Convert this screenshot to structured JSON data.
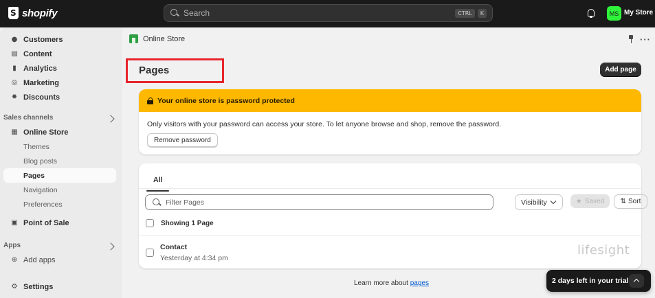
{
  "topbar": {
    "brand": "shopify",
    "search_placeholder": "Search",
    "shortcut_keys": [
      "CTRL",
      "K"
    ],
    "avatar_initials": "MS",
    "store_name": "My Store"
  },
  "sidebar": {
    "items": [
      {
        "label": "Customers",
        "icon": "person-icon"
      },
      {
        "label": "Content",
        "icon": "content-icon"
      },
      {
        "label": "Analytics",
        "icon": "bar-chart-icon"
      },
      {
        "label": "Marketing",
        "icon": "target-icon"
      },
      {
        "label": "Discounts",
        "icon": "discount-icon"
      }
    ],
    "sales_channels_label": "Sales channels",
    "online_store": {
      "label": "Online Store",
      "icon": "store-icon"
    },
    "sub_items": [
      "Themes",
      "Blog posts",
      "Pages",
      "Navigation",
      "Preferences"
    ],
    "point_of_sale": {
      "label": "Point of Sale",
      "icon": "pos-icon"
    },
    "apps_label": "Apps",
    "add_apps": "Add apps",
    "settings": "Settings"
  },
  "breadcrumb": {
    "label": "Online Store"
  },
  "page": {
    "title": "Pages",
    "add_button": "Add page"
  },
  "banner": {
    "title": "Your online store is password protected",
    "body": "Only visitors with your password can access your store. To let anyone browse and shop, remove the password.",
    "button": "Remove password",
    "color": "#ffb800"
  },
  "list": {
    "tab": "All",
    "filter_placeholder": "Filter Pages",
    "visibility": "Visibility",
    "saved": "Saved",
    "sort": "Sort",
    "showing": "Showing 1 Page",
    "rows": [
      {
        "title": "Contact",
        "date": "Yesterday at 4:34 pm"
      }
    ],
    "watermark": "lifesight"
  },
  "footer": {
    "learn_prefix": "Learn more about ",
    "learn_link": "pages"
  },
  "trial": {
    "label": "2 days left in your trial"
  }
}
